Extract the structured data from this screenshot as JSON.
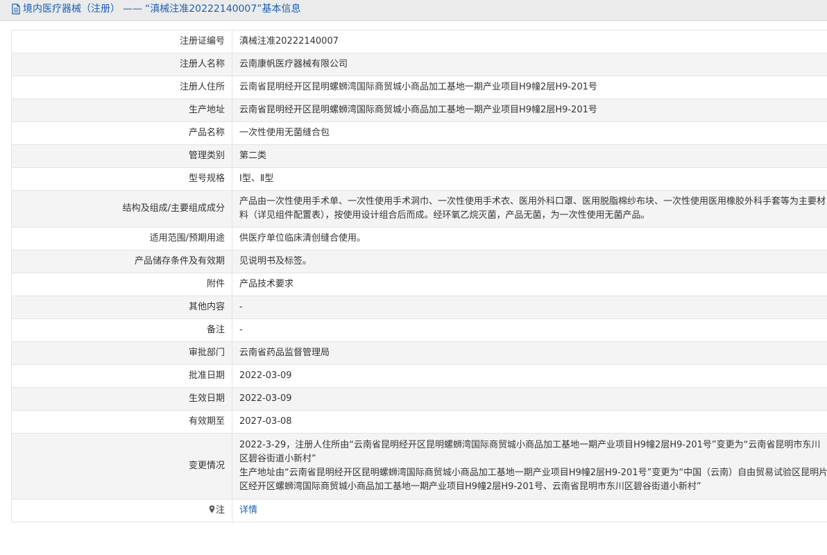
{
  "header": {
    "category": "境内医疗器械（注册）",
    "separator": "——",
    "title": "“滇械注准20222140007”基本信息"
  },
  "rows": [
    {
      "label": "注册证编号",
      "value": "滇械注准20222140007"
    },
    {
      "label": "注册人名称",
      "value": "云南康帆医疗器械有限公司"
    },
    {
      "label": "注册人住所",
      "value": "云南省昆明经开区昆明螺蛳湾国际商贸城小商品加工基地一期产业项目H9幢2层H9-201号"
    },
    {
      "label": "生产地址",
      "value": "云南省昆明经开区昆明螺蛳湾国际商贸城小商品加工基地一期产业项目H9幢2层H9-201号"
    },
    {
      "label": "产品名称",
      "value": "一次性使用无菌缝合包"
    },
    {
      "label": "管理类别",
      "value": "第二类"
    },
    {
      "label": "型号规格",
      "value": "Ⅰ型、Ⅱ型"
    },
    {
      "label": "结构及组成/主要组成成分",
      "value": "产品由一次性使用手术单、一次性使用手术洞巾、一次性使用手术衣、医用外科口罩、医用脱脂棉纱布块、一次性使用医用橡胶外科手套等为主要材料（详见组件配置表），按使用设计组合后而成。经环氧乙烷灭菌，产品无菌，为一次性使用无菌产品。"
    },
    {
      "label": "适用范围/预期用途",
      "value": "供医疗单位临床清创缝合使用。"
    },
    {
      "label": "产品储存条件及有效期",
      "value": "见说明书及标签。"
    },
    {
      "label": "附件",
      "value": "产品技术要求"
    },
    {
      "label": "其他内容",
      "value": "-"
    },
    {
      "label": "备注",
      "value": "-"
    },
    {
      "label": "审批部门",
      "value": "云南省药品监督管理局"
    },
    {
      "label": "批准日期",
      "value": "2022-03-09"
    },
    {
      "label": "生效日期",
      "value": "2022-03-09"
    },
    {
      "label": "有效期至",
      "value": "2027-03-08"
    }
  ],
  "changes": {
    "label": "变更情况",
    "line1": "2022-3-29，注册人住所由“云南省昆明经开区昆明螺蛳湾国际商贸城小商品加工基地一期产业项目H9幢2层H9-201号”变更为“云南省昆明市东川区碧谷街道小新村”",
    "line2": "生产地址由“云南省昆明经开区昆明螺蛳湾国际商贸城小商品加工基地一期产业项目H9幢2层H9-201号”变更为“中国（云南）自由贸易试验区昆明片区经开区螺蛳湾国际商贸城小商品加工基地一期产业项目H9幢2层H9-201号、云南省昆明市东川区碧谷街道小新村”"
  },
  "note": {
    "label": "注",
    "link": "详情"
  }
}
